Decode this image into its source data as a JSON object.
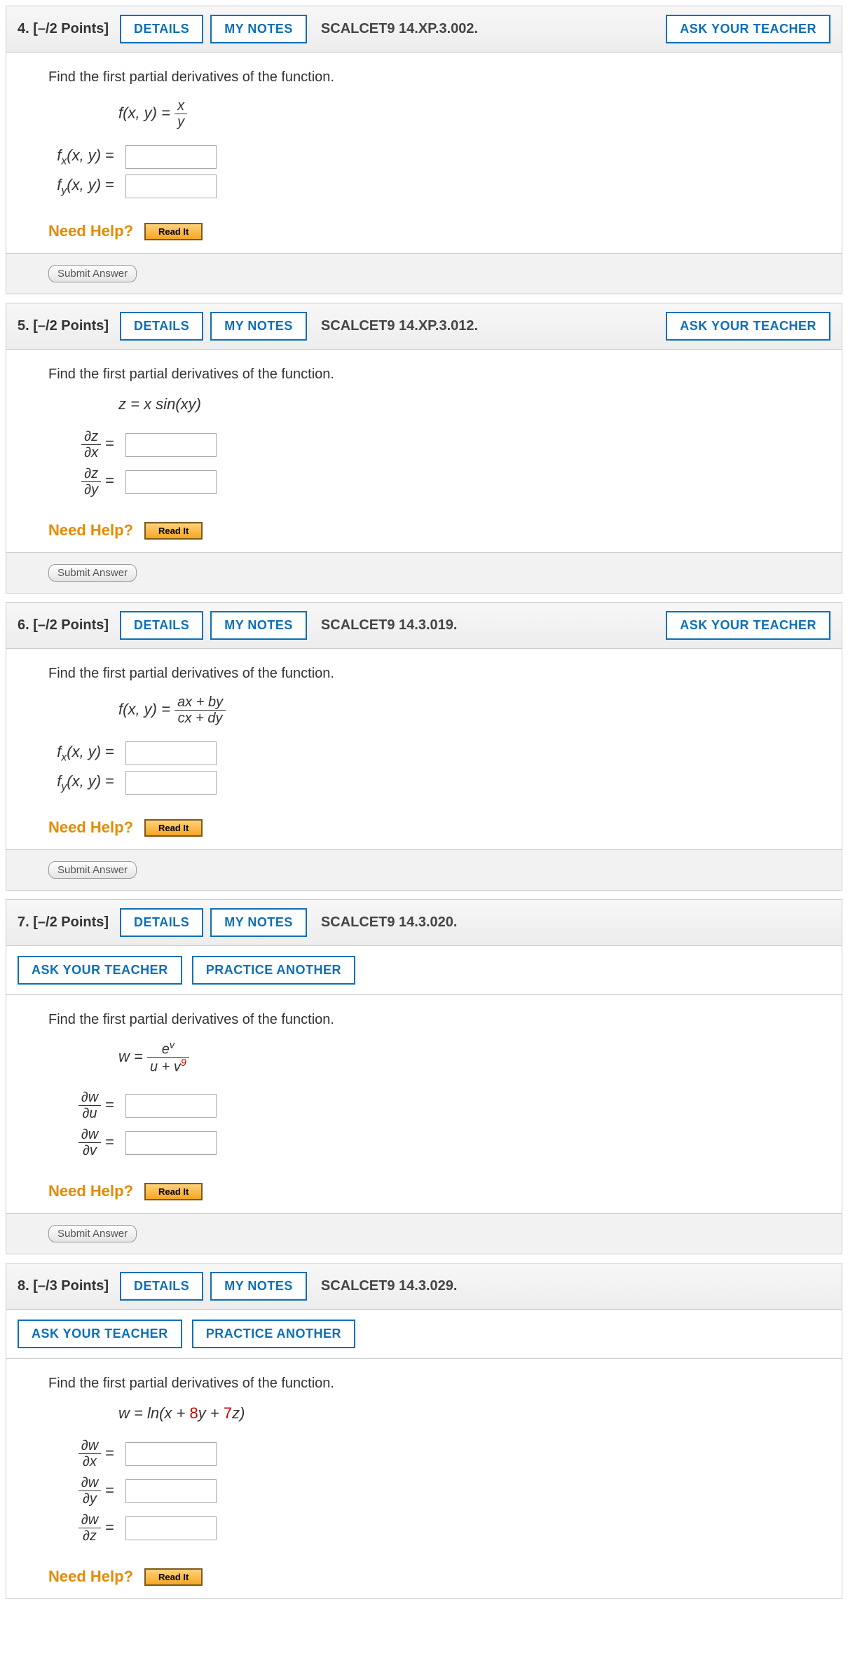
{
  "buttons": {
    "details": "DETAILS",
    "my_notes": "MY NOTES",
    "ask_teacher": "ASK YOUR TEACHER",
    "practice_another": "PRACTICE ANOTHER",
    "read_it": "Read It",
    "submit": "Submit Answer"
  },
  "need_help_label": "Need Help?",
  "questions": [
    {
      "num": "4.",
      "points": "[–/2 Points]",
      "code": "SCALCET9 14.XP.3.002.",
      "prompt": "Find the first partial derivatives of the function.",
      "formula_prefix": "f(x, y) =",
      "frac_num": "x",
      "frac_den": "y",
      "rows": [
        {
          "label_html": "f<span class='sub'>x</span>(x, y)"
        },
        {
          "label_html": "f<span class='sub'>y</span>(x, y)"
        }
      ],
      "extra_buttons": false
    },
    {
      "num": "5.",
      "points": "[–/2 Points]",
      "code": "SCALCET9 14.XP.3.012.",
      "prompt": "Find the first partial derivatives of the function.",
      "formula_inline": "z = x sin(xy)",
      "rows": [
        {
          "frac_num": "∂z",
          "frac_den": "∂x"
        },
        {
          "frac_num": "∂z",
          "frac_den": "∂y"
        }
      ],
      "extra_buttons": false
    },
    {
      "num": "6.",
      "points": "[–/2 Points]",
      "code": "SCALCET9 14.3.019.",
      "prompt": "Find the first partial derivatives of the function.",
      "formula_prefix": "f(x, y) =",
      "frac_num": "ax + by",
      "frac_den": "cx + dy",
      "rows": [
        {
          "label_html": "f<span class='sub'>x</span>(x, y)"
        },
        {
          "label_html": "f<span class='sub'>y</span>(x, y)"
        }
      ],
      "extra_buttons": false
    },
    {
      "num": "7.",
      "points": "[–/2 Points]",
      "code": "SCALCET9 14.3.020.",
      "prompt": "Find the first partial derivatives of the function.",
      "formula_prefix": "w =",
      "frac_num_html": "e<span class='sup'>v</span>",
      "frac_den_html": "u + v<span class='sup red'>9</span>",
      "rows": [
        {
          "frac_num": "∂w",
          "frac_den": "∂u"
        },
        {
          "frac_num": "∂w",
          "frac_den": "∂v"
        }
      ],
      "extra_buttons": true
    },
    {
      "num": "8.",
      "points": "[–/3 Points]",
      "code": "SCALCET9 14.3.029.",
      "prompt": "Find the first partial derivatives of the function.",
      "formula_inline_html": "w = ln(x + <span class='red' style='font-style:normal;'>8</span>y + <span class='red' style='font-style:normal;'>7</span>z)",
      "rows": [
        {
          "frac_num": "∂w",
          "frac_den": "∂x"
        },
        {
          "frac_num": "∂w",
          "frac_den": "∂y"
        },
        {
          "frac_num": "∂w",
          "frac_den": "∂z"
        }
      ],
      "extra_buttons": true,
      "no_submit": true
    }
  ]
}
